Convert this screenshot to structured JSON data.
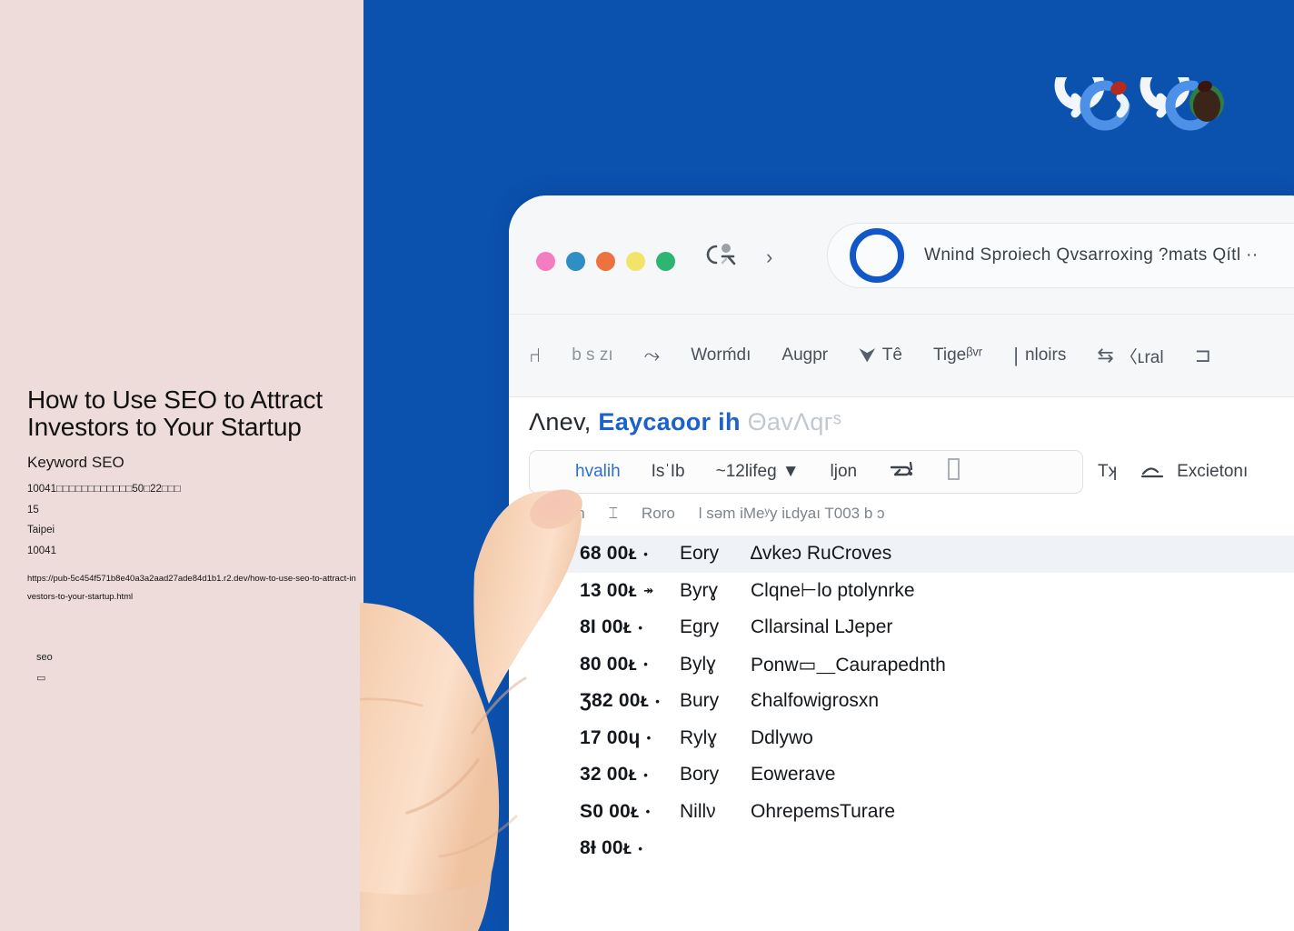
{
  "colors": {
    "left_panel_bg": "#EDDCD9",
    "page_blue": "#0B51AE",
    "accent_blue": "#1B62C9",
    "browser_bg": "#F6F7F9",
    "row_highlight": "#EFF2F7",
    "dot_pink": "#F47CC0",
    "dot_blue": "#2F8FC4",
    "dot_orange": "#EC7240",
    "dot_yellow": "#F2E468",
    "dot_green": "#2FB572"
  },
  "left_panel": {
    "title": "How to Use SEO to Attract Investors to Your Startup",
    "keyword_label": "Keyword SEO",
    "meta_line_1": "10041□□□□□□□□□□□□50□22□□□",
    "meta_line_2": "15",
    "meta_line_3": "Taipei",
    "meta_line_4": "10041",
    "url": "https://pub-5c454f571b8e40a3a2aad27ade84d1b1.r2.dev/how-to-use-seo-to-attract-investors-to-your-startup.html",
    "tag": "seo",
    "glyph": "▭"
  },
  "logo": {
    "name": "brand-logo",
    "alt": "stylized rounded letters logo"
  },
  "browser": {
    "window_dots": [
      "pink",
      "blue",
      "orange",
      "yellow",
      "green"
    ],
    "nav": {
      "back_icon": "back-navigation-icon",
      "forward_icon": "›"
    },
    "omnibox": {
      "text": "Wnind Sproiech Qvsarroxing ?mats Qítl  ··"
    },
    "toolbar": [
      {
        "glyph": "⑁",
        "label": "",
        "icon": "bookmark-glyph-icon",
        "muted": false
      },
      {
        "glyph": "",
        "label": "b s zı",
        "icon": "",
        "muted": true
      },
      {
        "glyph": "⤳",
        "label": "",
        "icon": "scatter-glyph-icon",
        "muted": true
      },
      {
        "glyph": "",
        "label": "Worḿdı",
        "icon": "",
        "muted": false
      },
      {
        "glyph": "",
        "label": "Augpr",
        "icon": "",
        "muted": false
      },
      {
        "glyph": "⮟",
        "label": "Tê",
        "icon": "flag-glyph-icon",
        "muted": false
      },
      {
        "glyph": "",
        "label": "Tigeᵝᵛʳ",
        "icon": "",
        "muted": false
      },
      {
        "glyph": "|",
        "label": "nloirs",
        "icon": "",
        "muted": false
      },
      {
        "glyph": "⇆",
        "label": "〈ʟral",
        "icon": "cart-glyph-icon",
        "muted": false
      },
      {
        "glyph": "⊐",
        "label": "",
        "icon": "frame-glyph-icon",
        "muted": false
      }
    ],
    "headline": {
      "lead": "Λnev,",
      "emphasis": "Eaycaoor ih",
      "trailing": "ΘavΛqгˢ"
    },
    "filter_bar": {
      "primary": "hvalih",
      "items": [
        {
          "label": "IsˈIb",
          "icon": ""
        },
        {
          "label": "~12lifeg",
          "icon": "chevron-down-icon"
        },
        {
          "label": "ljon",
          "icon": ""
        },
        {
          "label": "",
          "icon": "reply-glyph-icon"
        },
        {
          "label": "",
          "icon": "column-glyph-icon"
        }
      ]
    },
    "filter_right": [
      {
        "label": "Tʞ",
        "icon": ""
      },
      {
        "label": "Excietonı",
        "icon": "sort-glyph-icon"
      }
    ],
    "column_headers": [
      "Hlʳy oun",
      "⌶",
      "Roro",
      "l səm iMeʸy iʟdyaı T003 b ɔ"
    ],
    "rows": [
      {
        "value": "68 00ᴌ",
        "arrow": "•",
        "mid": "Eory",
        "text": "∆vkeɔ  RuCroves",
        "highlight": true
      },
      {
        "value": "13 00ᴌ",
        "arrow": "↠",
        "mid": "Byrɣ",
        "text": "Clqne⊢lo ptolynrke",
        "highlight": false
      },
      {
        "value": "8I 00ᴌ",
        "arrow": "•",
        "mid": "Egry",
        "text": "Cllarsinal LJeper",
        "highlight": false
      },
      {
        "value": "80 00ᴌ",
        "arrow": "•",
        "mid": "Bylɣ",
        "text": "Ponw▭⸏Caurapednth",
        "highlight": false
      },
      {
        "value": "Ʒ82 00ᴌ",
        "arrow": "•",
        "mid": "Bury",
        "text": "Ɛhalfowigrosxn",
        "highlight": false
      },
      {
        "value": "17 00ɥ",
        "arrow": "•",
        "mid": "Rylɣ",
        "text": "Ddlywo",
        "highlight": false
      },
      {
        "value": "32 00ᴌ",
        "arrow": "•",
        "mid": "Bory",
        "text": "Eowerave",
        "highlight": false
      },
      {
        "value": "S0 00ᴌ",
        "arrow": "•",
        "mid": "Nillν",
        "text": "OhrepemsTurare",
        "highlight": false
      },
      {
        "value": "8Ɨ 00ᴌ",
        "arrow": "•",
        "mid": "",
        "text": "",
        "highlight": false
      }
    ]
  },
  "hand": {
    "description": "photographic hand with index finger pointing at the screen"
  }
}
